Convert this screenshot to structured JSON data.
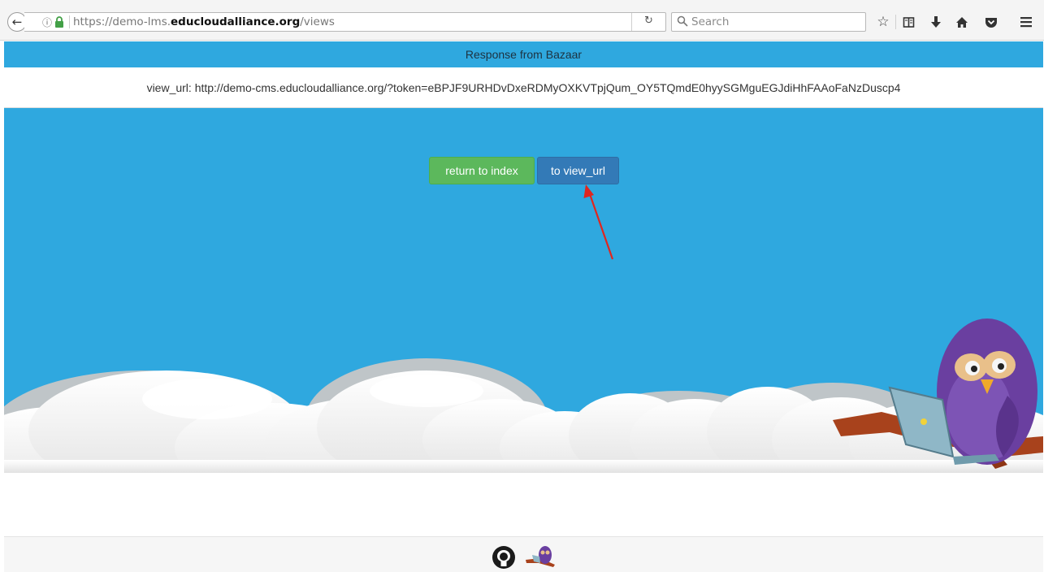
{
  "browser": {
    "url_prefix": "https://demo-lms.",
    "url_domain": "educloudalliance.org",
    "url_path": "/views",
    "search_placeholder": "Search",
    "icons": [
      "back-icon",
      "info-icon",
      "lock-icon",
      "reload-icon",
      "search-icon",
      "bookmark-star-icon",
      "reading-list-icon",
      "download-icon",
      "home-icon",
      "pocket-icon",
      "menu-icon"
    ]
  },
  "page": {
    "header": "Response from Bazaar",
    "view_url_line": "view_url: http://demo-cms.educloudalliance.org/?token=eBPJF9URHDvDxeRDMyOXKVTpjQum_OY5TQmdE0hyySGMguEGJdiHhFAAoFaNzDuscp4",
    "return_button": "return to index",
    "view_url_button": "to view_url",
    "colors": {
      "background": "#2fa8df",
      "return_button": "#5cb85c",
      "view_url_button": "#337ab7",
      "annotation_arrow": "#e0261f"
    }
  },
  "footer": {
    "icons": [
      "github-icon",
      "owl-logo-icon"
    ]
  }
}
